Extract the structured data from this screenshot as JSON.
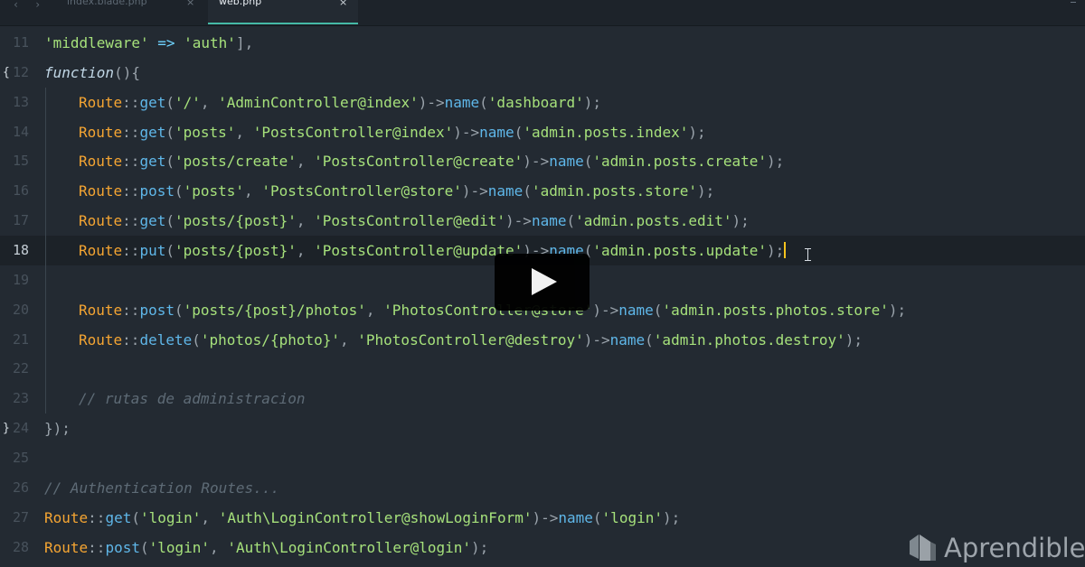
{
  "tabs": [
    {
      "label": "index.blade.php",
      "close": "×"
    },
    {
      "label": "web.php",
      "close": "×"
    }
  ],
  "nav": {
    "back": "‹",
    "forward": "›"
  },
  "lines": [
    {
      "num": "11",
      "fold": "",
      "code": [
        [
          "str",
          "'middleware'"
        ],
        [
          "t",
          " "
        ],
        [
          "op",
          "=>"
        ],
        [
          "t",
          " "
        ],
        [
          "str",
          "'auth'"
        ],
        [
          "t",
          "],"
        ]
      ]
    },
    {
      "num": "12",
      "fold": "{",
      "code": [
        [
          "it",
          "function"
        ],
        [
          "t",
          "(){"
        ]
      ]
    },
    {
      "num": "13",
      "fold": "",
      "code": [
        [
          "kw",
          "Route"
        ],
        [
          "t",
          "::"
        ],
        [
          "fn",
          "get"
        ],
        [
          "t",
          "("
        ],
        [
          "str",
          "'/'"
        ],
        [
          "t",
          ", "
        ],
        [
          "str",
          "'AdminController@index'"
        ],
        [
          "t",
          ")->"
        ],
        [
          "fn",
          "name"
        ],
        [
          "t",
          "("
        ],
        [
          "str",
          "'dashboard'"
        ],
        [
          "t",
          ");"
        ]
      ]
    },
    {
      "num": "14",
      "fold": "",
      "code": [
        [
          "kw",
          "Route"
        ],
        [
          "t",
          "::"
        ],
        [
          "fn",
          "get"
        ],
        [
          "t",
          "("
        ],
        [
          "str",
          "'posts'"
        ],
        [
          "t",
          ", "
        ],
        [
          "str",
          "'PostsController@index'"
        ],
        [
          "t",
          ")->"
        ],
        [
          "fn",
          "name"
        ],
        [
          "t",
          "("
        ],
        [
          "str",
          "'admin.posts.index'"
        ],
        [
          "t",
          ");"
        ]
      ]
    },
    {
      "num": "15",
      "fold": "",
      "code": [
        [
          "kw",
          "Route"
        ],
        [
          "t",
          "::"
        ],
        [
          "fn",
          "get"
        ],
        [
          "t",
          "("
        ],
        [
          "str",
          "'posts/create'"
        ],
        [
          "t",
          ", "
        ],
        [
          "str",
          "'PostsController@create'"
        ],
        [
          "t",
          ")->"
        ],
        [
          "fn",
          "name"
        ],
        [
          "t",
          "("
        ],
        [
          "str",
          "'admin.posts.create'"
        ],
        [
          "t",
          ");"
        ]
      ]
    },
    {
      "num": "16",
      "fold": "",
      "code": [
        [
          "kw",
          "Route"
        ],
        [
          "t",
          "::"
        ],
        [
          "fn",
          "post"
        ],
        [
          "t",
          "("
        ],
        [
          "str",
          "'posts'"
        ],
        [
          "t",
          ", "
        ],
        [
          "str",
          "'PostsController@store'"
        ],
        [
          "t",
          ")->"
        ],
        [
          "fn",
          "name"
        ],
        [
          "t",
          "("
        ],
        [
          "str",
          "'admin.posts.store'"
        ],
        [
          "t",
          ");"
        ]
      ]
    },
    {
      "num": "17",
      "fold": "",
      "code": [
        [
          "kw",
          "Route"
        ],
        [
          "t",
          "::"
        ],
        [
          "fn",
          "get"
        ],
        [
          "t",
          "("
        ],
        [
          "str",
          "'posts/{post}'"
        ],
        [
          "t",
          ", "
        ],
        [
          "str",
          "'PostsController@edit'"
        ],
        [
          "t",
          ")->"
        ],
        [
          "fn",
          "name"
        ],
        [
          "t",
          "("
        ],
        [
          "str",
          "'admin.posts.edit'"
        ],
        [
          "t",
          ");"
        ]
      ]
    },
    {
      "num": "18",
      "fold": "",
      "current": true,
      "code": [
        [
          "kw",
          "Route"
        ],
        [
          "t",
          "::"
        ],
        [
          "fn",
          "put"
        ],
        [
          "t",
          "("
        ],
        [
          "str",
          "'posts/{post}'"
        ],
        [
          "t",
          ", "
        ],
        [
          "str",
          "'PostsController@update'"
        ],
        [
          "t",
          ")->"
        ],
        [
          "fn",
          "name"
        ],
        [
          "t",
          "("
        ],
        [
          "str",
          "'admin.posts.update'"
        ],
        [
          "t",
          ");"
        ]
      ]
    },
    {
      "num": "19",
      "fold": "",
      "code": []
    },
    {
      "num": "20",
      "fold": "",
      "code": [
        [
          "kw",
          "Route"
        ],
        [
          "t",
          "::"
        ],
        [
          "fn",
          "post"
        ],
        [
          "t",
          "("
        ],
        [
          "str",
          "'posts/{post}/photos'"
        ],
        [
          "t",
          ", "
        ],
        [
          "str",
          "'PhotosController@store'"
        ],
        [
          "t",
          ")->"
        ],
        [
          "fn",
          "name"
        ],
        [
          "t",
          "("
        ],
        [
          "str",
          "'admin.posts.photos.store'"
        ],
        [
          "t",
          ");"
        ]
      ]
    },
    {
      "num": "21",
      "fold": "",
      "code": [
        [
          "kw",
          "Route"
        ],
        [
          "t",
          "::"
        ],
        [
          "fn",
          "delete"
        ],
        [
          "t",
          "("
        ],
        [
          "str",
          "'photos/{photo}'"
        ],
        [
          "t",
          ", "
        ],
        [
          "str",
          "'PhotosController@destroy'"
        ],
        [
          "t",
          ")->"
        ],
        [
          "fn",
          "name"
        ],
        [
          "t",
          "("
        ],
        [
          "str",
          "'admin.photos.destroy'"
        ],
        [
          "t",
          ");"
        ]
      ]
    },
    {
      "num": "22",
      "fold": "",
      "code": []
    },
    {
      "num": "23",
      "fold": "",
      "code": [
        [
          "comment",
          "// rutas de administracion"
        ]
      ]
    },
    {
      "num": "24",
      "fold": "}",
      "code": [
        [
          "t",
          "});"
        ]
      ]
    },
    {
      "num": "25",
      "fold": "",
      "code": []
    },
    {
      "num": "26",
      "fold": "",
      "code": [
        [
          "comment",
          "// Authentication Routes..."
        ]
      ]
    },
    {
      "num": "27",
      "fold": "",
      "code": [
        [
          "kw",
          "Route"
        ],
        [
          "t",
          "::"
        ],
        [
          "fn",
          "get"
        ],
        [
          "t",
          "("
        ],
        [
          "str",
          "'login'"
        ],
        [
          "t",
          ", "
        ],
        [
          "str",
          "'Auth\\LoginController@showLoginForm'"
        ],
        [
          "t",
          ")->"
        ],
        [
          "fn",
          "name"
        ],
        [
          "t",
          "("
        ],
        [
          "str",
          "'login'"
        ],
        [
          "t",
          ");"
        ]
      ]
    },
    {
      "num": "28",
      "fold": "",
      "code": [
        [
          "kw",
          "Route"
        ],
        [
          "t",
          "::"
        ],
        [
          "fn",
          "post"
        ],
        [
          "t",
          "("
        ],
        [
          "str",
          "'login'"
        ],
        [
          "t",
          ", "
        ],
        [
          "str",
          "'Auth\\LoginController@login'"
        ],
        [
          "t",
          ");"
        ]
      ]
    }
  ],
  "brand": {
    "name": "Aprendible"
  },
  "colors": {
    "accent": "#45b9a6",
    "cursor": "#f4c21e",
    "background": "#232a32"
  }
}
